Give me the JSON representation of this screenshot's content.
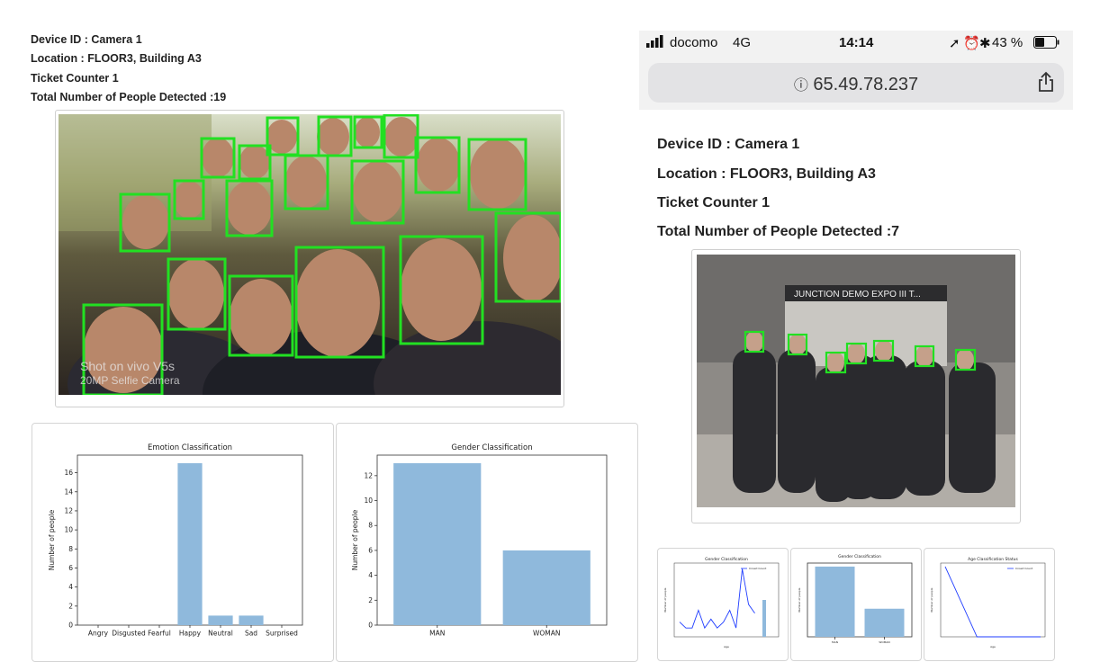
{
  "left_panel": {
    "device_id": "Device ID : Camera 1",
    "location": "Location : FLOOR3, Building A3",
    "counter": "Ticket Counter 1",
    "people_detected": "Total Number of People Detected :19",
    "photo_watermark": "Shot on vivo V5s\n20MP Selfie Camera"
  },
  "right_panel": {
    "device_id": "Device ID : Camera 1",
    "location": "Location : FLOOR3, Building A3",
    "counter": "Ticket Counter 1",
    "people_detected": "Total Number of People Detected :7",
    "screen_text": "JUNCTION  DEMO EXPO III T..."
  },
  "status_bar": {
    "carrier": "docomo",
    "network": "4G",
    "time": "14:14",
    "battery": "43 %",
    "url": "65.49.78.237",
    "icons": [
      "signal-icon",
      "location-arrow-icon",
      "alarm-icon",
      "bluetooth-icon",
      "battery-icon",
      "info-icon",
      "share-icon"
    ]
  },
  "colors": {
    "bar_fill": "#8fb9dc",
    "face_box": "#22e022",
    "line_blue": "#1f3cff"
  },
  "chart_data": [
    {
      "type": "bar",
      "title": "Emotion Classification",
      "xlabel": "",
      "ylabel": "Number of people",
      "categories": [
        "Angry",
        "Disgusted",
        "Fearful",
        "Happy",
        "Neutral",
        "Sad",
        "Surprised"
      ],
      "values": [
        0,
        0,
        0,
        17,
        1,
        1,
        0
      ],
      "ylim": [
        0,
        17.85
      ],
      "yticks": [
        0,
        2,
        4,
        6,
        8,
        10,
        12,
        14,
        16
      ]
    },
    {
      "type": "bar",
      "title": "Gender Classification",
      "xlabel": "",
      "ylabel": "Number of people",
      "categories": [
        "MAN",
        "WOMAN"
      ],
      "values": [
        13,
        6
      ],
      "ylim": [
        0,
        13.65
      ],
      "yticks": [
        0,
        2,
        4,
        6,
        8,
        10,
        12
      ]
    },
    {
      "type": "line",
      "title": "Gender Classification",
      "xlabel": "Age",
      "ylabel": "Number of people",
      "legend": "Crowd Count",
      "values": [
        1,
        0.6,
        0.6,
        1.8,
        0.6,
        1.2,
        0.6,
        1.0,
        1.8,
        0.6,
        4.6,
        2.2,
        1.6
      ],
      "extra_bar": 2.5,
      "ylim": [
        0,
        5
      ]
    },
    {
      "type": "bar",
      "title": "Gender Classification",
      "xlabel": "",
      "ylabel": "Number of people",
      "categories": [
        "MAN",
        "WOMAN"
      ],
      "values": [
        5,
        2
      ],
      "ylim": [
        0,
        5.25
      ]
    },
    {
      "type": "line",
      "title": "Age Classification Status",
      "xlabel": "Age",
      "ylabel": "Number of people",
      "legend": "Crowd Count",
      "values": [
        4,
        0,
        0,
        0
      ],
      "ylim": [
        0,
        4.2
      ]
    }
  ]
}
